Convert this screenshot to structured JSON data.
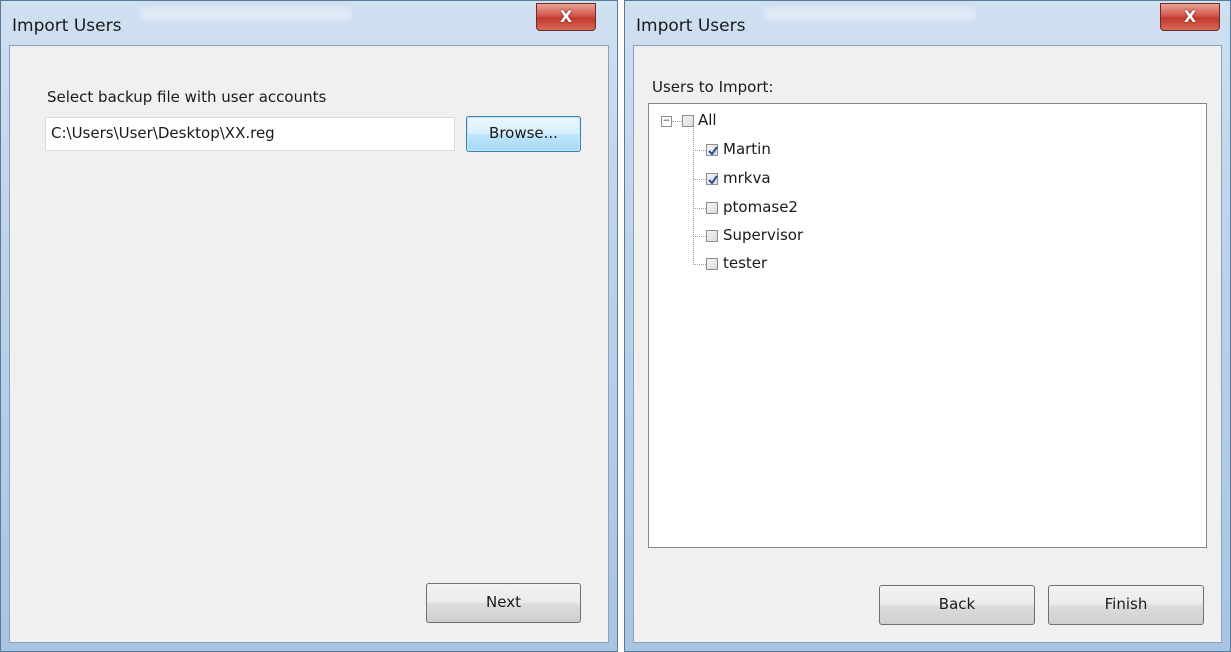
{
  "left_window": {
    "title": "Import Users",
    "close_glyph": "X",
    "prompt": "Select backup file with user accounts",
    "file_path_value": "C:\\Users\\User\\Desktop\\XX.reg",
    "browse_label": "Browse...",
    "next_label": "Next"
  },
  "right_window": {
    "title": "Import Users",
    "close_glyph": "X",
    "users_label": "Users to Import:",
    "tree": {
      "root": {
        "label": "All",
        "checked": false,
        "expanded": true
      },
      "children": [
        {
          "label": "Martin",
          "checked": true
        },
        {
          "label": "mrkva",
          "checked": true
        },
        {
          "label": "ptomase2",
          "checked": false
        },
        {
          "label": "Supervisor",
          "checked": false
        },
        {
          "label": "tester",
          "checked": false
        }
      ]
    },
    "back_label": "Back",
    "finish_label": "Finish"
  },
  "icons": {
    "close": "close-icon",
    "expander": "minus-box-icon",
    "checkbox_checked": "checkmark-icon"
  },
  "colors": {
    "title_bar": "#bcd2ea",
    "close_button": "#c23b2c",
    "client_bg": "#f0f0f0",
    "focus_border": "#3c7fb1"
  }
}
